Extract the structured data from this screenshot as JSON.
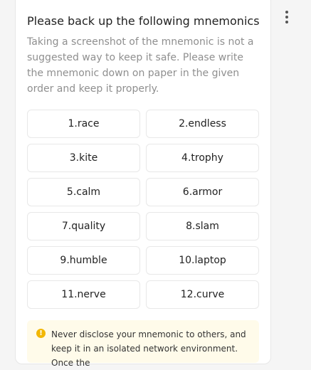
{
  "title": "Please back up the following mnemonics",
  "description": "Taking a screenshot of the mnemonic is not a suggested way to keep it safe. Please write the mnemonic down on paper in the given order and keep it properly.",
  "words": [
    "1.race",
    "2.endless",
    "3.kite",
    "4.trophy",
    "5.calm",
    "6.armor",
    "7.quality",
    "8.slam",
    "9.humble",
    "10.laptop",
    "11.nerve",
    "12.curve"
  ],
  "notice": {
    "icon": "warning-icon",
    "text": "Never disclose your mnemonic to others, and keep it in an isolated network environment. Once the"
  },
  "colors": {
    "warning": "#f2b705",
    "notice_bg": "#fffbea"
  }
}
